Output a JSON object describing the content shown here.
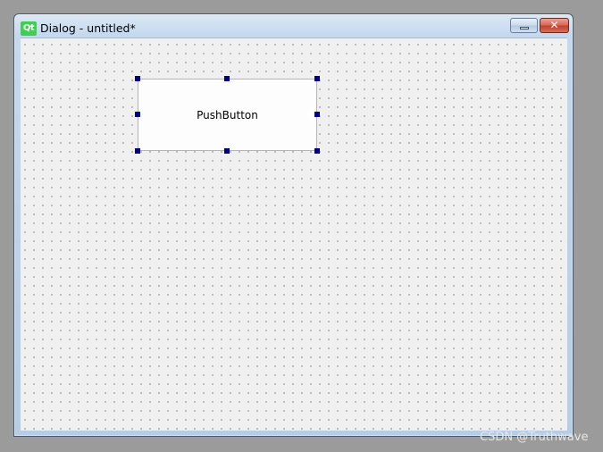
{
  "window": {
    "title": "Dialog - untitled*",
    "logo_text": "Qt",
    "close_glyph": "✕",
    "minimize_icon": "minimize-icon",
    "close_icon": "close-icon"
  },
  "form": {
    "pushbutton_label": "PushButton",
    "grid": "dotted",
    "selected_widget": "PushButton"
  },
  "watermark": "CSDN @Truthwave",
  "colors": {
    "selection_handle": "#000080",
    "qt_green": "#41cd52",
    "close_red": "#c2412c",
    "form_background": "#f0f0f0"
  }
}
